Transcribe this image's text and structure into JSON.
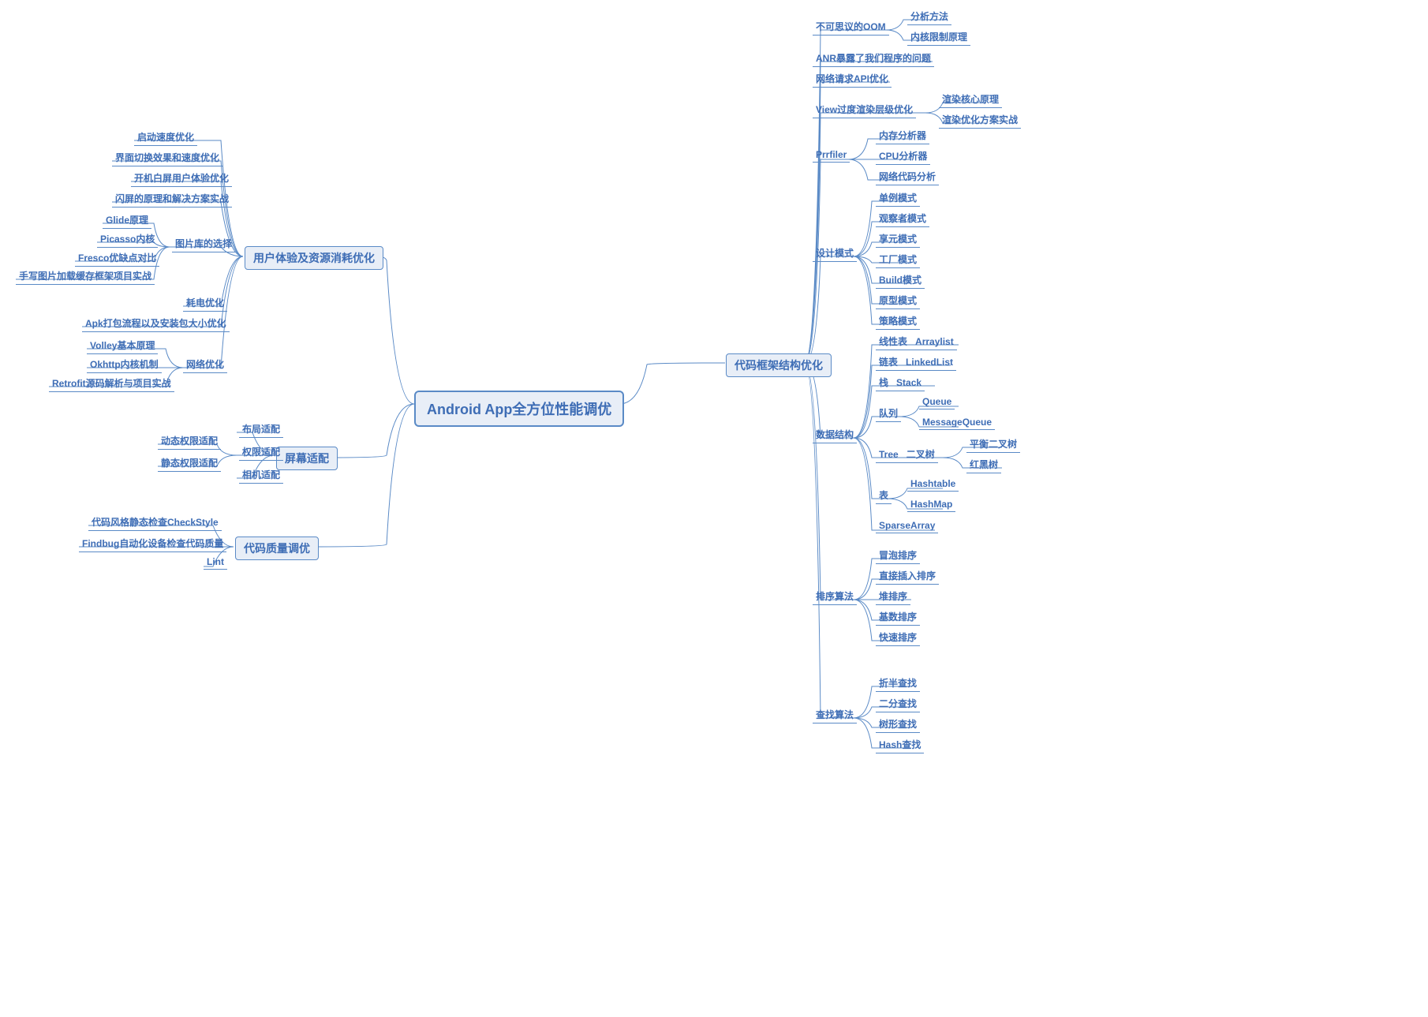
{
  "root": "Android App全方位性能调优",
  "left": {
    "ux": {
      "title": "用户体验及资源消耗优化",
      "startup": [
        "启动速度优化",
        "界面切换效果和速度优化",
        "开机白屏用户体验优化",
        "闪屏的原理和解决方案实战"
      ],
      "imglib": {
        "title": "图片库的选择",
        "items": [
          "Glide原理",
          "Picasso内核",
          "Fresco优缺点对比",
          "手写图片加载缓存框架项目实战"
        ]
      },
      "misc": [
        "耗电优化",
        "Apk打包流程以及安装包大小优化"
      ],
      "net": {
        "title": "网络优化",
        "items": [
          "Volley基本原理",
          "Okhttp内核机制",
          "Retrofit源码解析与项目实战"
        ]
      }
    },
    "screen": {
      "title": "屏幕适配",
      "layout": "布局适配",
      "perm": {
        "title": "权限适配",
        "items": [
          "动态权限适配",
          "静态权限适配"
        ]
      },
      "camera": "相机适配"
    },
    "quality": {
      "title": "代码质量调优",
      "items": [
        "代码风格静态检查CheckStyle",
        "Findbug自动化设备检查代码质量",
        "Lint"
      ]
    }
  },
  "right": {
    "title": "代码框架结构优化",
    "oom": {
      "title": "不可思议的OOM",
      "items": [
        "分析方法",
        "内核限制原理"
      ]
    },
    "anr": "ANR暴露了我们程序的问题",
    "netapi": "网络请求API优化",
    "view": {
      "title": "View过度渲染层级优化",
      "items": [
        "渲染核心原理",
        "渲染优化方案实战"
      ]
    },
    "profiler": {
      "title": "Prrfiler",
      "items": [
        "内存分析器",
        "CPU分析器",
        "网络代码分析"
      ]
    },
    "patterns": {
      "title": "设计模式",
      "items": [
        "单例模式",
        "观察者模式",
        "享元模式",
        "工厂模式",
        "Build模式",
        "原型模式",
        "策略模式"
      ]
    },
    "ds": {
      "title": "数据结构",
      "linear": {
        "title": "线性表",
        "value": "Arraylist"
      },
      "linked": {
        "title": "链表",
        "value": "LinkedList"
      },
      "stack": {
        "title": "栈",
        "value": "Stack"
      },
      "queue": {
        "title": "队列",
        "items": [
          "Queue",
          "MessageQueue"
        ]
      },
      "tree": {
        "title": "Tree",
        "mid": "二叉树",
        "items": [
          "平衡二叉树",
          "红黑树"
        ]
      },
      "table": {
        "title": "表",
        "items": [
          "Hashtable",
          "HashMap"
        ]
      },
      "sparse": "SparseArray"
    },
    "sort": {
      "title": "排序算法",
      "items": [
        "冒泡排序",
        "直接插入排序",
        "堆排序",
        "基数排序",
        "快速排序"
      ]
    },
    "search": {
      "title": "查找算法",
      "items": [
        "折半查找",
        "二分查找",
        "树形查找",
        "Hash查找"
      ]
    }
  }
}
